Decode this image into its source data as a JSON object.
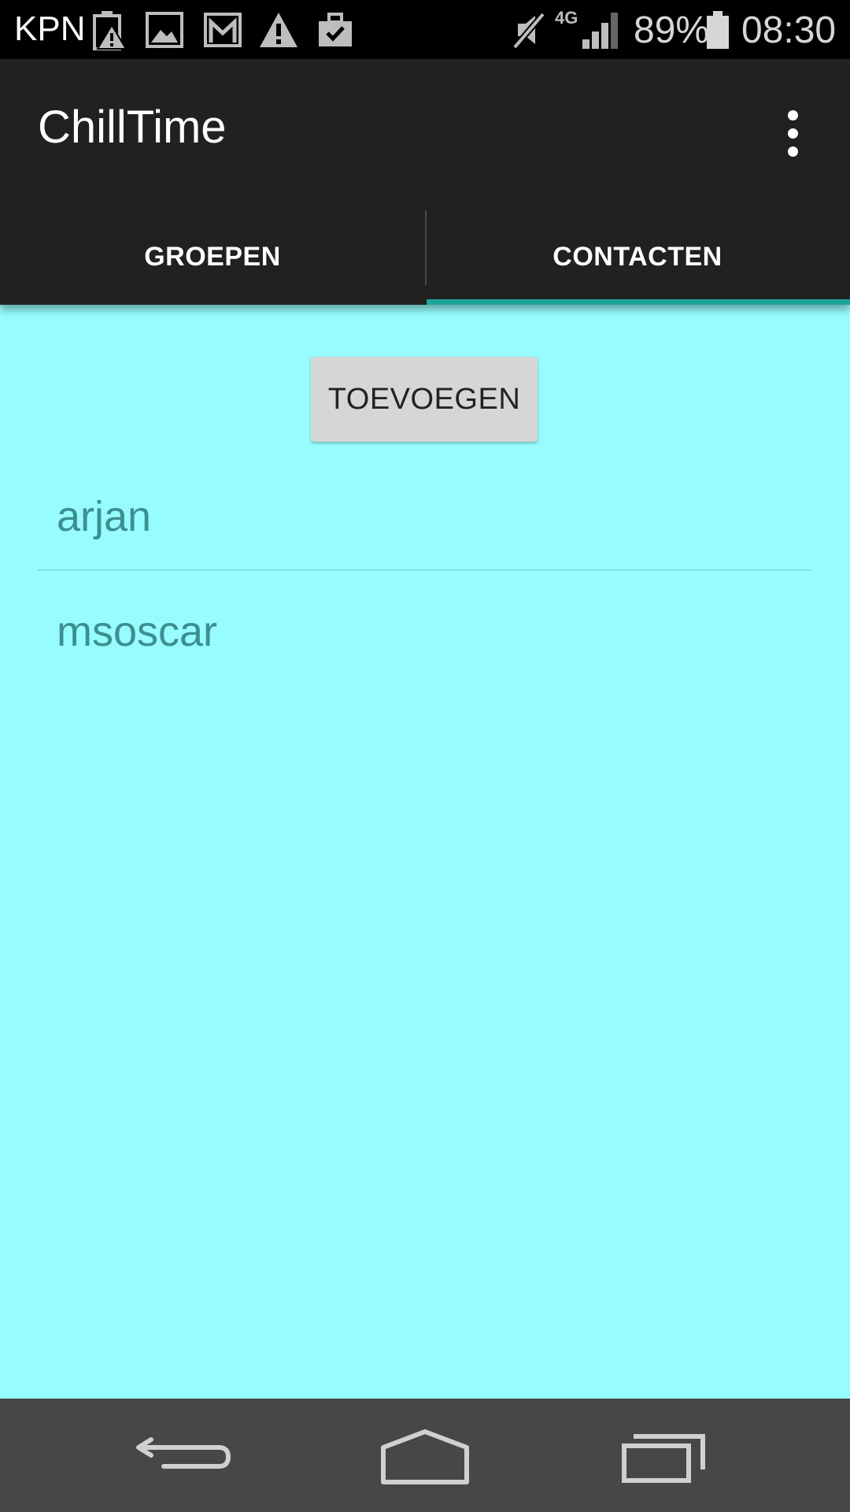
{
  "status_bar": {
    "carrier": "KPN",
    "network_type": "4G",
    "battery_percent": "89%",
    "time": "08:30",
    "icons": [
      "battery-alert-icon",
      "image-icon",
      "gmail-icon",
      "warning-icon",
      "briefcase-check-icon",
      "mute-icon",
      "signal-icon",
      "battery-icon"
    ]
  },
  "app_bar": {
    "title": "ChillTime",
    "menu_icon": "overflow-menu-icon"
  },
  "tabs": [
    {
      "label": "GROEPEN",
      "selected": false
    },
    {
      "label": "CONTACTEN",
      "selected": true
    }
  ],
  "main": {
    "add_button_label": "TOEVOEGEN",
    "contacts": [
      {
        "name": "arjan"
      },
      {
        "name": "msoscar"
      }
    ]
  },
  "nav_bar": {
    "icons": [
      "back-icon",
      "home-icon",
      "recents-icon"
    ]
  },
  "colors": {
    "background": "#96fcfd",
    "app_bar": "#212121",
    "tab_indicator": "#1fa29b",
    "contact_text": "#3d8f8f",
    "button_bg": "#d6d6d6",
    "nav_bar": "#474747"
  }
}
